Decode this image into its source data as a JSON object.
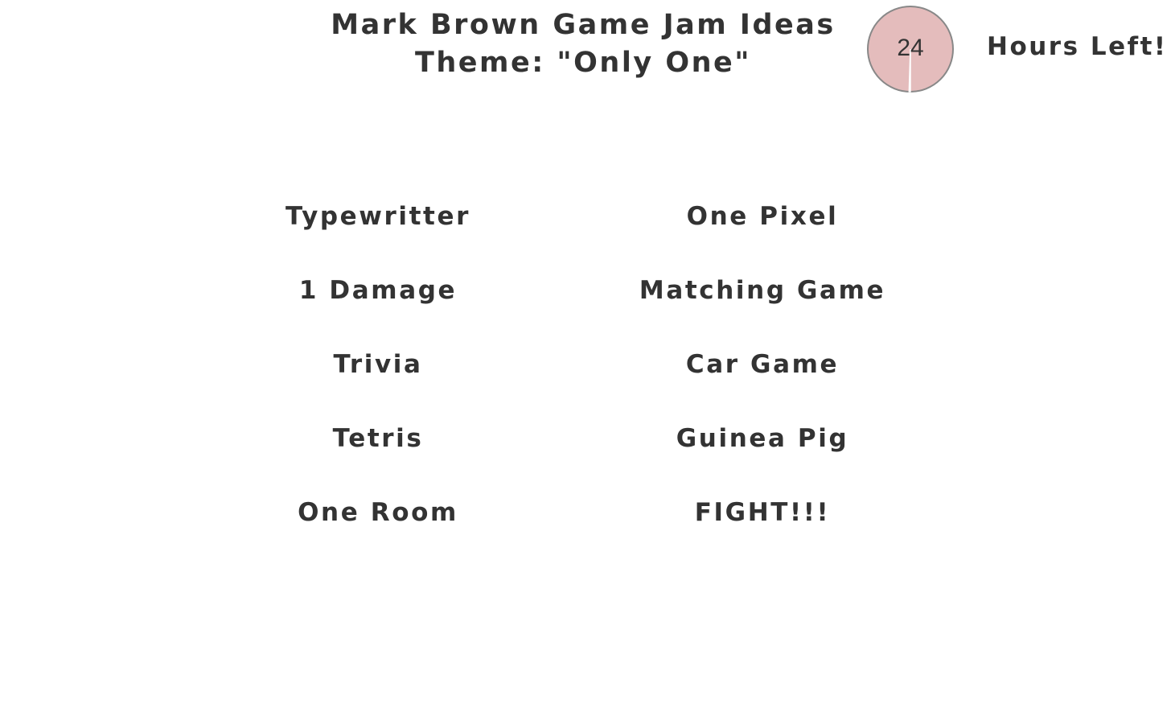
{
  "header": {
    "title_line1": "Mark Brown Game Jam Ideas",
    "title_line2": "Theme: \"Only One\""
  },
  "timer": {
    "value": "24",
    "caption": "Hours Left!",
    "remaining_fraction": 0.995,
    "fill_color": "#e4bcbc",
    "stroke_color": "#888888"
  },
  "ideas": {
    "left_column": [
      "Typewritter",
      "1 Damage",
      "Trivia",
      "Tetris",
      "One Room"
    ],
    "right_column": [
      "One Pixel",
      "Matching Game",
      "Car Game",
      "Guinea Pig",
      "FIGHT!!!"
    ]
  }
}
